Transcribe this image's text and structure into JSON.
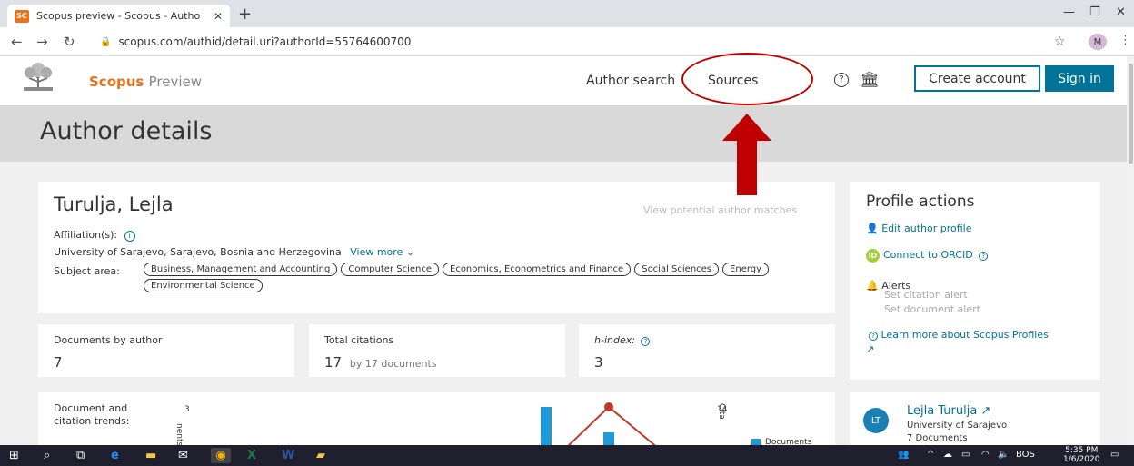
{
  "browser": {
    "tab_title": "Scopus preview - Scopus - Autho",
    "favicon_text": "SC",
    "url": "scopus.com/authid/detail.uri?authorId=55764600700",
    "profile_initial": "M"
  },
  "header": {
    "brand": "Scopus",
    "brand_suffix": "Preview",
    "nav_author_search": "Author search",
    "nav_sources": "Sources",
    "create_account": "Create account",
    "sign_in": "Sign in",
    "brand_color": "#e9711c",
    "accent_color": "#007398"
  },
  "page": {
    "title": "Author details"
  },
  "author": {
    "name": "Turulja, Lejla",
    "view_potential": "View potential author matches",
    "affiliation_label": "Affiliation(s):",
    "affiliation": "University of Sarajevo, Sarajevo, Bosnia and Herzegovina",
    "view_more": "View more",
    "subject_label": "Subject area:",
    "subjects": [
      "Business, Management and Accounting",
      "Computer Science",
      "Economics, Econometrics and Finance",
      "Social Sciences",
      "Energy",
      "Environmental Science"
    ]
  },
  "stats": {
    "docs_label": "Documents by author",
    "docs_value": "7",
    "citations_label": "Total citations",
    "citations_value": "17",
    "citations_sub": "by 17 documents",
    "hindex_label": "h-index:",
    "hindex_value": "3"
  },
  "profile_actions": {
    "title": "Profile actions",
    "edit": "Edit author profile",
    "orcid": "Connect to ORCID",
    "alerts": "Alerts",
    "set_citation_alert": "Set citation alert",
    "set_document_alert": "Set document alert",
    "learn_more": "Learn more about Scopus Profiles"
  },
  "trends": {
    "label": "Document and citation trends:",
    "left_axis_top": "3",
    "left_axis_label": "nents",
    "right_axis_top": "14",
    "right_axis_label": "Cita",
    "legend_documents": "Documents"
  },
  "profile_card": {
    "initials": "LT",
    "name": "Lejla Turulja",
    "institution": "University of Sarajevo",
    "documents": "7 Documents"
  },
  "taskbar": {
    "lang": "BOS",
    "time": "5:35 PM",
    "date": "1/6/2020"
  }
}
